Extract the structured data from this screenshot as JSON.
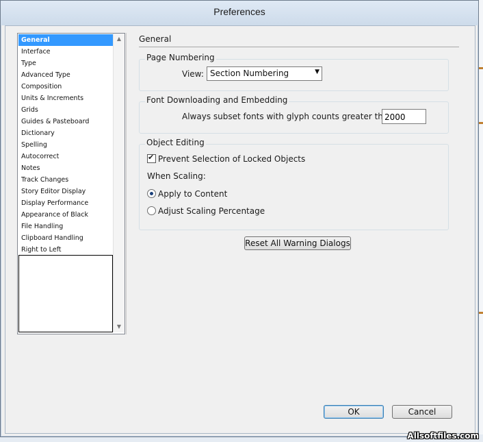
{
  "window": {
    "title": "Preferences"
  },
  "categories": [
    {
      "label": "General",
      "selected": true
    },
    {
      "label": "Interface"
    },
    {
      "label": "Type"
    },
    {
      "label": "Advanced Type"
    },
    {
      "label": "Composition"
    },
    {
      "label": "Units & Increments"
    },
    {
      "label": "Grids"
    },
    {
      "label": "Guides & Pasteboard"
    },
    {
      "label": "Dictionary"
    },
    {
      "label": "Spelling"
    },
    {
      "label": "Autocorrect"
    },
    {
      "label": "Notes"
    },
    {
      "label": "Track Changes"
    },
    {
      "label": "Story Editor Display"
    },
    {
      "label": "Display Performance"
    },
    {
      "label": "Appearance of Black"
    },
    {
      "label": "File Handling"
    },
    {
      "label": "Clipboard Handling"
    },
    {
      "label": "Right to Left"
    }
  ],
  "panel": {
    "heading": "General",
    "page_numbering": {
      "label": "Page Numbering",
      "view_label": "View:",
      "view_value": "Section Numbering"
    },
    "font_downloading": {
      "label": "Font Downloading and Embedding",
      "subset_label": "Always subset fonts with glyph counts greater than:",
      "subset_value": "2000"
    },
    "object_editing": {
      "label": "Object Editing",
      "prevent_selection_label": "Prevent Selection of Locked Objects",
      "prevent_selection_checked": true,
      "when_scaling_label": "When Scaling:",
      "apply_to_content_label": "Apply to Content",
      "adjust_scaling_label": "Adjust Scaling Percentage",
      "scaling_selected": "Apply to Content"
    },
    "reset_button": "Reset All Warning Dialogs"
  },
  "buttons": {
    "ok": "OK",
    "cancel": "Cancel"
  },
  "watermark": "Allsoftfiles.com",
  "colors": {
    "selection": "#3399ff",
    "dialog_bg": "#f0f0f0",
    "title_bar": "#dfe9f5"
  }
}
